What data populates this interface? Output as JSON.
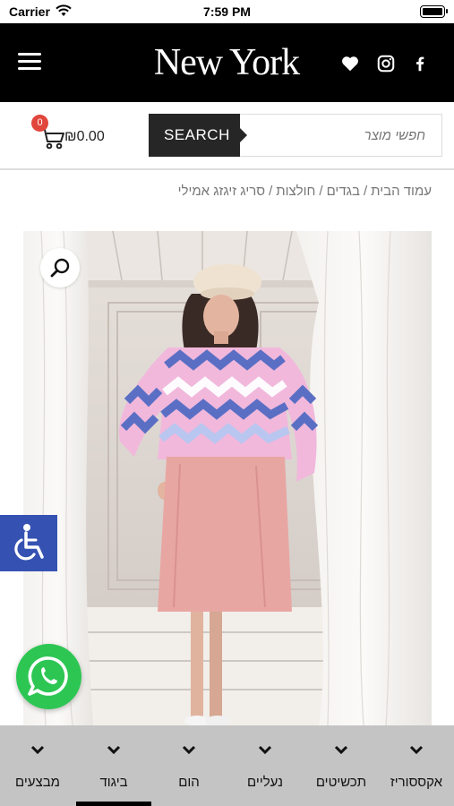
{
  "status_bar": {
    "carrier": "Carrier",
    "time": "7:59 PM"
  },
  "header": {
    "logo": "New York",
    "icons": [
      "menu-icon",
      "heart-icon",
      "instagram-icon",
      "facebook-icon"
    ]
  },
  "search": {
    "placeholder": "חפשי מוצר",
    "button_label": "SEARCH"
  },
  "cart": {
    "count": "0",
    "total": "₪0.00"
  },
  "breadcrumb": [
    "עמוד הבית",
    "בגדים",
    "חולצות",
    "סריג זיגזג אמילי"
  ],
  "bottom_nav": {
    "items": [
      {
        "label": "אקססוריז"
      },
      {
        "label": "תכשיטים"
      },
      {
        "label": "נעליים"
      },
      {
        "label": "הום"
      },
      {
        "label": "ביגוד",
        "active": true
      },
      {
        "label": "מבצעים"
      }
    ]
  },
  "colors": {
    "header_bg": "#000000",
    "accessibility_blue": "#3552b3",
    "whatsapp_green": "#2dc653",
    "cart_badge": "#e1463c",
    "bottom_nav_bg": "#c4c4c4"
  }
}
